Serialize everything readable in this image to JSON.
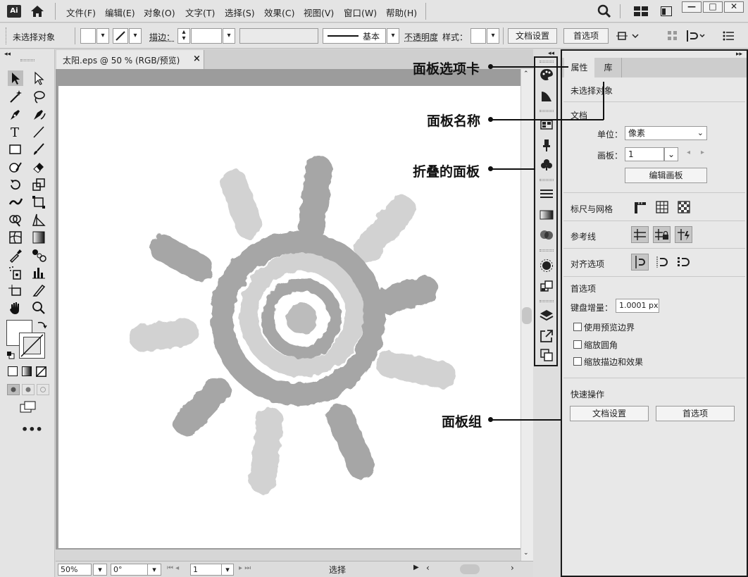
{
  "app": {
    "logo": "Ai"
  },
  "menu": [
    "文件(F)",
    "编辑(E)",
    "对象(O)",
    "文字(T)",
    "选择(S)",
    "效果(C)",
    "视图(V)",
    "窗口(W)",
    "帮助(H)"
  ],
  "window_controls": {
    "minimize": "—",
    "maximize": "□",
    "close": "✕"
  },
  "control_bar": {
    "selection": "未选择对象",
    "stroke_label": "描边：",
    "stroke_style": "基本",
    "opacity_label": "不透明度",
    "style_label": "样式：",
    "doc_setup": "文档设置",
    "preferences": "首选项"
  },
  "document": {
    "tab_title": "太阳.eps @ 50 % (RGB/预览)",
    "close": "×"
  },
  "statusbar": {
    "zoom": "50%",
    "rotation": "0°",
    "artboard": "1",
    "tool": "选择"
  },
  "panel": {
    "tabs": [
      "属性",
      "库"
    ],
    "no_selection": "未选择对象",
    "document_section": "文档",
    "unit_label": "单位：",
    "unit_value": "像素",
    "artboard_label": "画板：",
    "artboard_value": "1",
    "edit_artboards": "编辑画板",
    "rulers_grids": "标尺与网格",
    "guides": "参考线",
    "snap_options": "对齐选项",
    "preferences_section": "首选项",
    "keyboard_increment_label": "键盘增量：",
    "keyboard_increment_value": "1.0001 px",
    "checkboxes": [
      "使用预览边界",
      "缩放圆角",
      "缩放描边和效果"
    ],
    "quick_actions": "快速操作",
    "qa_doc_setup": "文档设置",
    "qa_preferences": "首选项"
  },
  "callouts": {
    "panel_tab": "面板选项卡",
    "panel_name": "面板名称",
    "collapsed_panel": "折叠的面板",
    "panel_group": "面板组"
  },
  "colors": {
    "sun_dark": "#a8a8a8",
    "sun_light": "#d3d3d3",
    "ui_bg": "#e4e4e4"
  }
}
